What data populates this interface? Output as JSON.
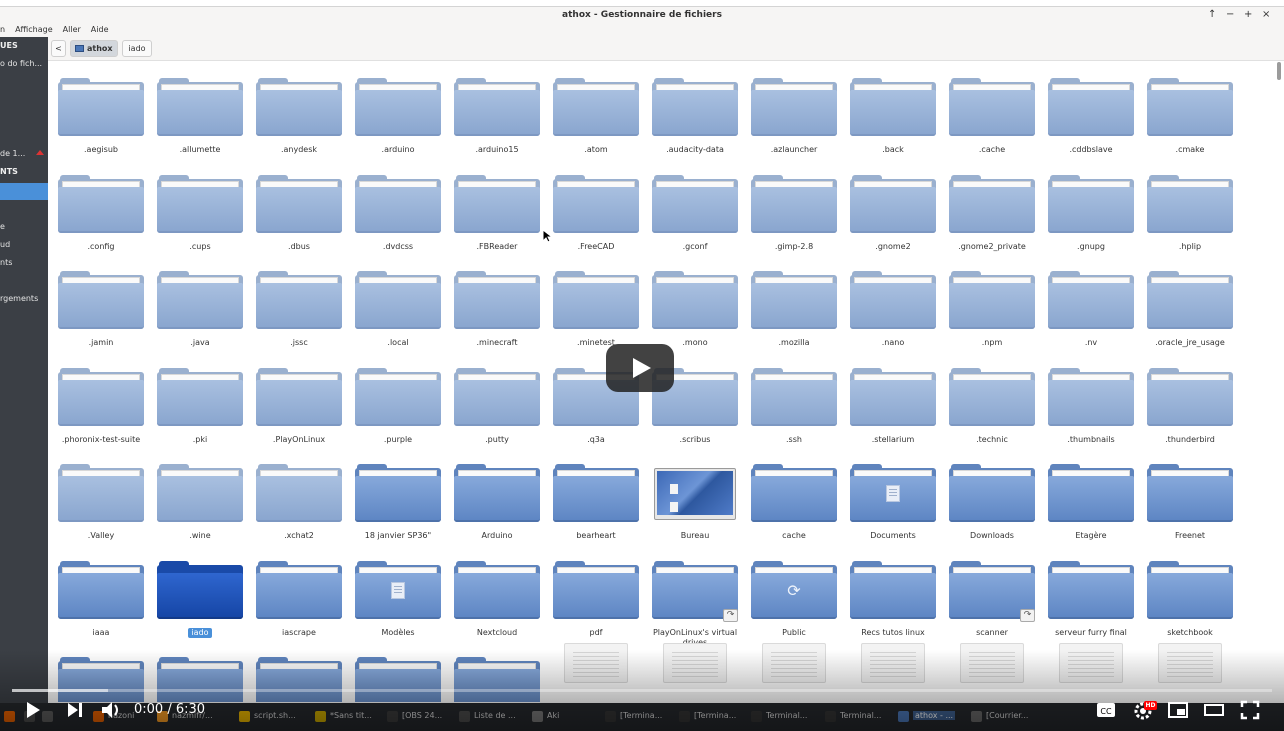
{
  "window": {
    "title": "athox - Gestionnaire de fichiers",
    "controls": [
      "↑",
      "−",
      "+",
      "×"
    ]
  },
  "menu": [
    "n",
    "Affichage",
    "Aller",
    "Aide"
  ],
  "sidebar": {
    "items": [
      "UES",
      "o do fich...",
      "de 1...",
      "NTS",
      "e",
      "ud",
      "nts",
      "rgements"
    ]
  },
  "pathbar": {
    "back": "<",
    "crumbs": [
      "athox",
      "iado"
    ]
  },
  "rows": [
    [
      ".aegisub",
      ".allumette",
      ".anydesk",
      ".arduino",
      ".arduino15",
      ".atom",
      ".audacity-data",
      ".azlauncher",
      ".back",
      ".cache",
      ".cddbslave",
      ".cmake"
    ],
    [
      ".config",
      ".cups",
      ".dbus",
      ".dvdcss",
      ".FBReader",
      ".FreeCAD",
      ".gconf",
      ".gimp-2.8",
      ".gnome2",
      ".gnome2_private",
      ".gnupg",
      ".hplip"
    ],
    [
      ".jamin",
      ".java",
      ".jssc",
      ".local",
      ".minecraft",
      ".minetest",
      ".mono",
      ".mozilla",
      ".nano",
      ".npm",
      ".nv",
      ".oracle_jre_usage"
    ],
    [
      ".phoronix-test-suite",
      ".pki",
      ".PlayOnLinux",
      ".purple",
      ".putty",
      ".q3a",
      ".scribus",
      ".ssh",
      ".stellarium",
      ".technic",
      ".thumbnails",
      ".thunderbird"
    ],
    [
      ".Valley",
      ".wine",
      ".xchat2",
      "18 janvier SP36\"",
      "Arduino",
      "bearheart",
      "Bureau",
      "cache",
      "Documents",
      "Downloads",
      "Etagère",
      "Freenet"
    ],
    [
      "iaaa",
      "iado",
      "iascrape",
      "Modèles",
      "Nextcloud",
      "pdf",
      "PlayOnLinux's virtual drives",
      "Public",
      "Recs tutos linux",
      "scanner",
      "serveur furry final",
      "sketchbook"
    ]
  ],
  "player": {
    "time": "0:00 / 6:30",
    "progress_percent": 0,
    "hd_badge": "HD"
  },
  "taskbar": [
    "nazoni",
    "nazmifr/...",
    "script.sh...",
    "*Sans tit...",
    "[OBS 24...",
    "Liste de ...",
    "Aki",
    "[Termina...",
    "[Termina...",
    "Terminal...",
    "Terminal...",
    "athox - ...",
    "[Courrier..."
  ]
}
